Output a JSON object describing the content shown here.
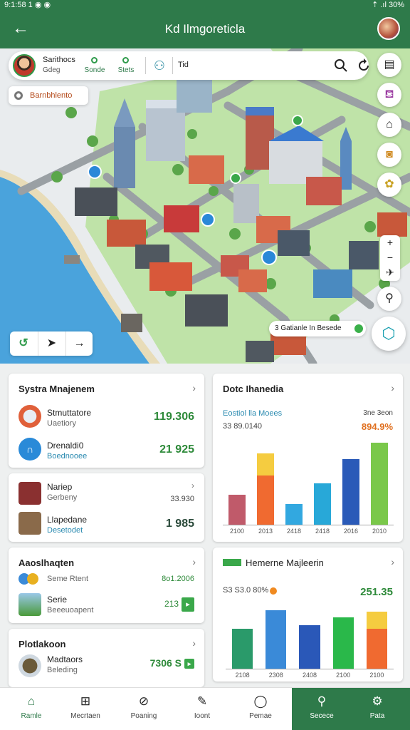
{
  "status": {
    "time": "9:1:58 1 ◉ ◉",
    "right": "⇡ .ıl 30%"
  },
  "header": {
    "title": "Kd Ilmgoreticla"
  },
  "user_card": {
    "name": "Sarithocs",
    "sub": "Gdeg",
    "tag1": "Sonde",
    "tag2": "Stets",
    "search_label": "Tid"
  },
  "map": {
    "location_chip": "Barnbhlento",
    "place_label": "3 Gatianle In Besede",
    "side_buttons": [
      "document-icon",
      "teapot-icon",
      "house-icon",
      "camera-icon",
      "flower-icon"
    ],
    "zoom": [
      "+",
      "−",
      "✈"
    ]
  },
  "system_card": {
    "title": "Systra Mnajenem",
    "rows": [
      {
        "title": "Stmuttatore",
        "sub": "Uaetiory",
        "value": "119.306"
      },
      {
        "title": "Drenaldi0",
        "sub": "Boednooee",
        "value": "21 925"
      }
    ]
  },
  "chart1": {
    "title": "Dotc Ihanedia",
    "sub1": "Eostiol lla Moees",
    "sub2": "33 89.0140",
    "right1": "3ne 3eon",
    "right2": "894.9%"
  },
  "card2": {
    "rows": [
      {
        "title": "Nariep",
        "sub": "Gerbeny",
        "value": "33.930"
      },
      {
        "title": "Llapedane",
        "sub": "Desetodet",
        "value": "1 985"
      }
    ]
  },
  "card3": {
    "title": "Aaoslhaqten",
    "rows": [
      {
        "title": "Seme Rtent",
        "value": "8o1.2006"
      },
      {
        "title": "Serie",
        "sub": "Beeeuoapent",
        "value": "213"
      }
    ]
  },
  "chart2": {
    "title": "Hemerne Majleerin",
    "sub1": "S3 S3.0 80%",
    "right": "251.35"
  },
  "card4": {
    "title": "Plotlakoon",
    "rows": [
      {
        "title": "Madtaors",
        "sub": "Beleding",
        "value": "7306 S"
      }
    ]
  },
  "chart_data": [
    {
      "type": "bar",
      "title": "Dotc Ihanedia",
      "categories": [
        "2100",
        "2013",
        "2418",
        "2418",
        "2016",
        "2010"
      ],
      "stacked_values": [
        [
          44
        ],
        [
          72,
          32
        ],
        [
          30
        ],
        [
          60
        ],
        [
          96
        ],
        [
          120
        ]
      ],
      "colors": [
        [
          "#c05a6a"
        ],
        [
          "#f06a30",
          "#f5cc40"
        ],
        [
          "#32a8e0"
        ],
        [
          "#28a8d8"
        ],
        [
          "#2a5ab8"
        ],
        [
          "#7ac84a"
        ]
      ],
      "ylim": [
        0,
        125
      ]
    },
    {
      "type": "bar",
      "title": "Hemerne Majleerin",
      "categories": [
        "2108",
        "2308",
        "2408",
        "2100",
        "2100"
      ],
      "stacked_values": [
        [
          56
        ],
        [
          82
        ],
        [
          61
        ],
        [
          72
        ],
        [
          56,
          24
        ]
      ],
      "colors": [
        [
          "#2a9a6a"
        ],
        [
          "#3a8ad8"
        ],
        [
          "#2a58b8"
        ],
        [
          "#2ab84a"
        ],
        [
          "#f06a30",
          "#f5cc40"
        ]
      ],
      "ylim": [
        0,
        90
      ]
    }
  ],
  "bottom_nav": [
    {
      "label": "Ramle"
    },
    {
      "label": "Mecrtaen"
    },
    {
      "label": "Poaning"
    },
    {
      "label": "Ioont"
    },
    {
      "label": "Pemae"
    },
    {
      "label": "Secece"
    },
    {
      "label": "Pata"
    }
  ]
}
